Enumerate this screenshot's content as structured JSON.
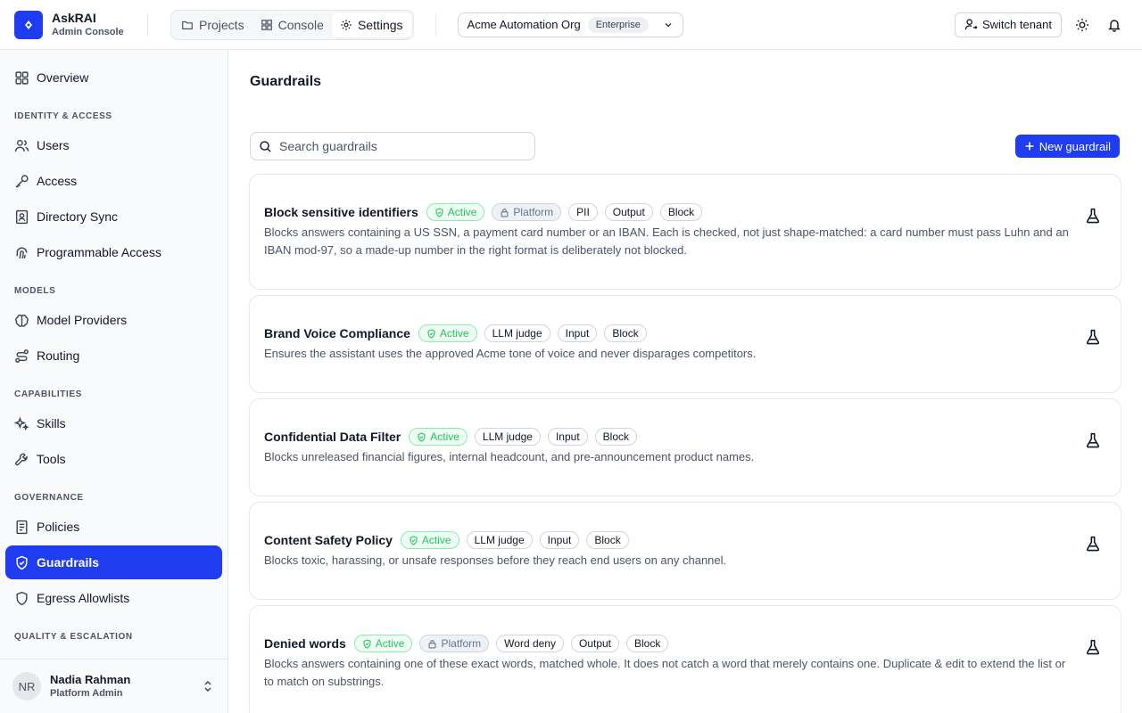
{
  "brand": {
    "name": "AskRAI",
    "subtitle": "Admin Console"
  },
  "nav": {
    "tabs": [
      {
        "label": "Projects",
        "icon": "folder-icon"
      },
      {
        "label": "Console",
        "icon": "grid-icon"
      },
      {
        "label": "Settings",
        "icon": "gear-icon",
        "active": true
      }
    ]
  },
  "org": {
    "name": "Acme Automation Org",
    "plan": "Enterprise"
  },
  "topbar": {
    "switch_tenant": "Switch tenant"
  },
  "sidebar": {
    "overview": "Overview",
    "sections": {
      "identity": "IDENTITY & ACCESS",
      "models": "MODELS",
      "capabilities": "CAPABILITIES",
      "governance": "GOVERNANCE",
      "quality": "QUALITY & ESCALATION"
    },
    "items": {
      "users": "Users",
      "access": "Access",
      "directory_sync": "Directory Sync",
      "programmable_access": "Programmable Access",
      "model_providers": "Model Providers",
      "routing": "Routing",
      "skills": "Skills",
      "tools": "Tools",
      "policies": "Policies",
      "guardrails": "Guardrails",
      "egress": "Egress Allowlists"
    },
    "active": "guardrails"
  },
  "user": {
    "initials": "NR",
    "name": "Nadia Rahman",
    "role": "Platform Admin"
  },
  "main": {
    "title": "Guardrails",
    "search_placeholder": "Search guardrails",
    "new_button": "New guardrail",
    "guardrails": [
      {
        "title": "Block sensitive identifiers",
        "status": "Active",
        "platform": "Platform",
        "tags": [
          "PII",
          "Output",
          "Block"
        ],
        "description": "Blocks answers containing a US SSN, a payment card number or an IBAN. Each is checked, not just shape-matched: a card number must pass Luhn and an IBAN mod-97, so a made-up number in the right format is deliberately not blocked."
      },
      {
        "title": "Brand Voice Compliance",
        "status": "Active",
        "platform": "",
        "tags": [
          "LLM judge",
          "Input",
          "Block"
        ],
        "description": "Ensures the assistant uses the approved Acme tone of voice and never disparages competitors."
      },
      {
        "title": "Confidential Data Filter",
        "status": "Active",
        "platform": "",
        "tags": [
          "LLM judge",
          "Input",
          "Block"
        ],
        "description": "Blocks unreleased financial figures, internal headcount, and pre-announcement product names."
      },
      {
        "title": "Content Safety Policy",
        "status": "Active",
        "platform": "",
        "tags": [
          "LLM judge",
          "Input",
          "Block"
        ],
        "description": "Blocks toxic, harassing, or unsafe responses before they reach end users on any channel."
      },
      {
        "title": "Denied words",
        "status": "Active",
        "platform": "Platform",
        "tags": [
          "Word deny",
          "Output",
          "Block"
        ],
        "description": "Blocks answers containing one of these exact words, matched whole. It does not catch a word that merely contains one. Duplicate & edit to extend the list or to match on substrings."
      }
    ]
  },
  "colors": {
    "accent": "#1f3cf0",
    "active_green": "#22c55e"
  }
}
